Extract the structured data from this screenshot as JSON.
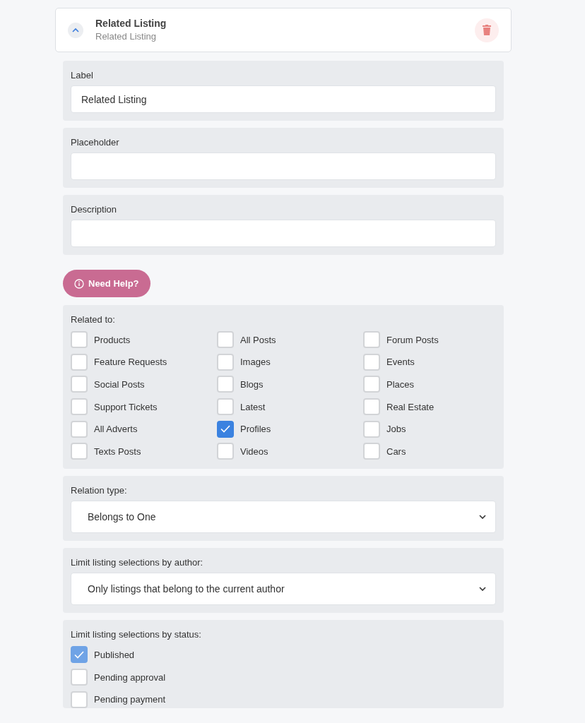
{
  "header": {
    "title": "Related Listing",
    "subtitle": "Related Listing",
    "expanded": true
  },
  "fields": [
    {
      "label": "Label",
      "value": "Related Listing"
    },
    {
      "label": "Placeholder"
    },
    {
      "label": "Description"
    }
  ],
  "help_button": {
    "label": "Need Help?"
  },
  "related_to": {
    "label": "Related to:",
    "options": [
      {
        "label": "Products",
        "checked": false
      },
      {
        "label": "All Posts",
        "checked": false
      },
      {
        "label": "Forum Posts",
        "checked": false
      },
      {
        "label": "Feature Requests",
        "checked": false
      },
      {
        "label": "Images",
        "checked": false
      },
      {
        "label": "Events",
        "checked": false
      },
      {
        "label": "Social Posts",
        "checked": false
      },
      {
        "label": "Blogs",
        "checked": false
      },
      {
        "label": "Places",
        "checked": false
      },
      {
        "label": "Support Tickets",
        "checked": false
      },
      {
        "label": "Latest",
        "checked": false
      },
      {
        "label": "Real Estate",
        "checked": false
      },
      {
        "label": "All Adverts",
        "checked": false
      },
      {
        "label": "Profiles",
        "checked": true
      },
      {
        "label": "Jobs",
        "checked": false
      },
      {
        "label": "Texts Posts",
        "checked": false
      },
      {
        "label": "Videos",
        "checked": false
      },
      {
        "label": "Cars",
        "checked": false
      }
    ]
  },
  "relation_type": {
    "label": "Relation type:",
    "value": "Belongs to One"
  },
  "author_limit": {
    "label": "Limit listing selections by author:",
    "value": "Only listings that belong to the current author"
  },
  "status_limit": {
    "label": "Limit listing selections by status:",
    "options": [
      {
        "label": "Published",
        "checked": true
      },
      {
        "label": "Pending approval",
        "checked": false
      },
      {
        "label": "Pending payment",
        "checked": false
      }
    ]
  }
}
